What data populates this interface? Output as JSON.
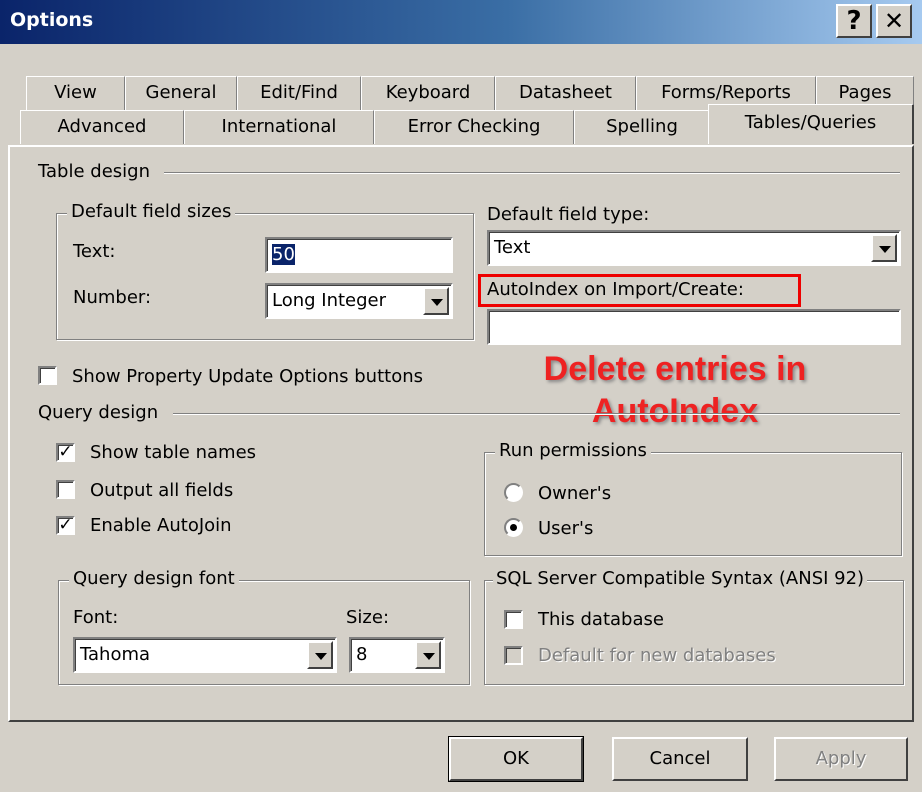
{
  "window": {
    "title": "Options",
    "help_glyph": "?",
    "close_glyph": "✕"
  },
  "tabs_row1": [
    "View",
    "General",
    "Edit/Find",
    "Keyboard",
    "Datasheet",
    "Forms/Reports",
    "Pages"
  ],
  "tabs_row2": [
    "Advanced",
    "International",
    "Error Checking",
    "Spelling",
    "Tables/Queries"
  ],
  "selected_tab": "Tables/Queries",
  "table_design": {
    "section_label": "Table design",
    "default_field_sizes": {
      "group_label": "Default field sizes",
      "text_label": "Text:",
      "text_value": "50",
      "number_label": "Number:",
      "number_value": "Long Integer"
    },
    "default_field_type": {
      "label": "Default field type:",
      "value": "Text"
    },
    "autoindex": {
      "label": "AutoIndex on Import/Create:",
      "value": ""
    },
    "show_property_update": {
      "label": "Show Property Update Options buttons",
      "checked": false
    }
  },
  "query_design": {
    "section_label": "Query design",
    "show_table_names": {
      "label": "Show table names",
      "checked": true
    },
    "output_all_fields": {
      "label": "Output all fields",
      "checked": false
    },
    "enable_autojoin": {
      "label": "Enable AutoJoin",
      "checked": true
    },
    "run_permissions": {
      "group_label": "Run permissions",
      "owners": "Owner's",
      "users": "User's",
      "selected": "User's"
    },
    "font": {
      "group_label": "Query design font",
      "font_label": "Font:",
      "font_value": "Tahoma",
      "size_label": "Size:",
      "size_value": "8"
    },
    "sql_syntax": {
      "group_label": "SQL Server Compatible Syntax (ANSI 92)",
      "this_database": "This database",
      "default_new": "Default for new databases"
    }
  },
  "annotation": {
    "line1": "Delete entries in",
    "line2": "AutoIndex",
    "color": "#ee2222"
  },
  "buttons": {
    "ok": "OK",
    "cancel": "Cancel",
    "apply": "Apply"
  }
}
